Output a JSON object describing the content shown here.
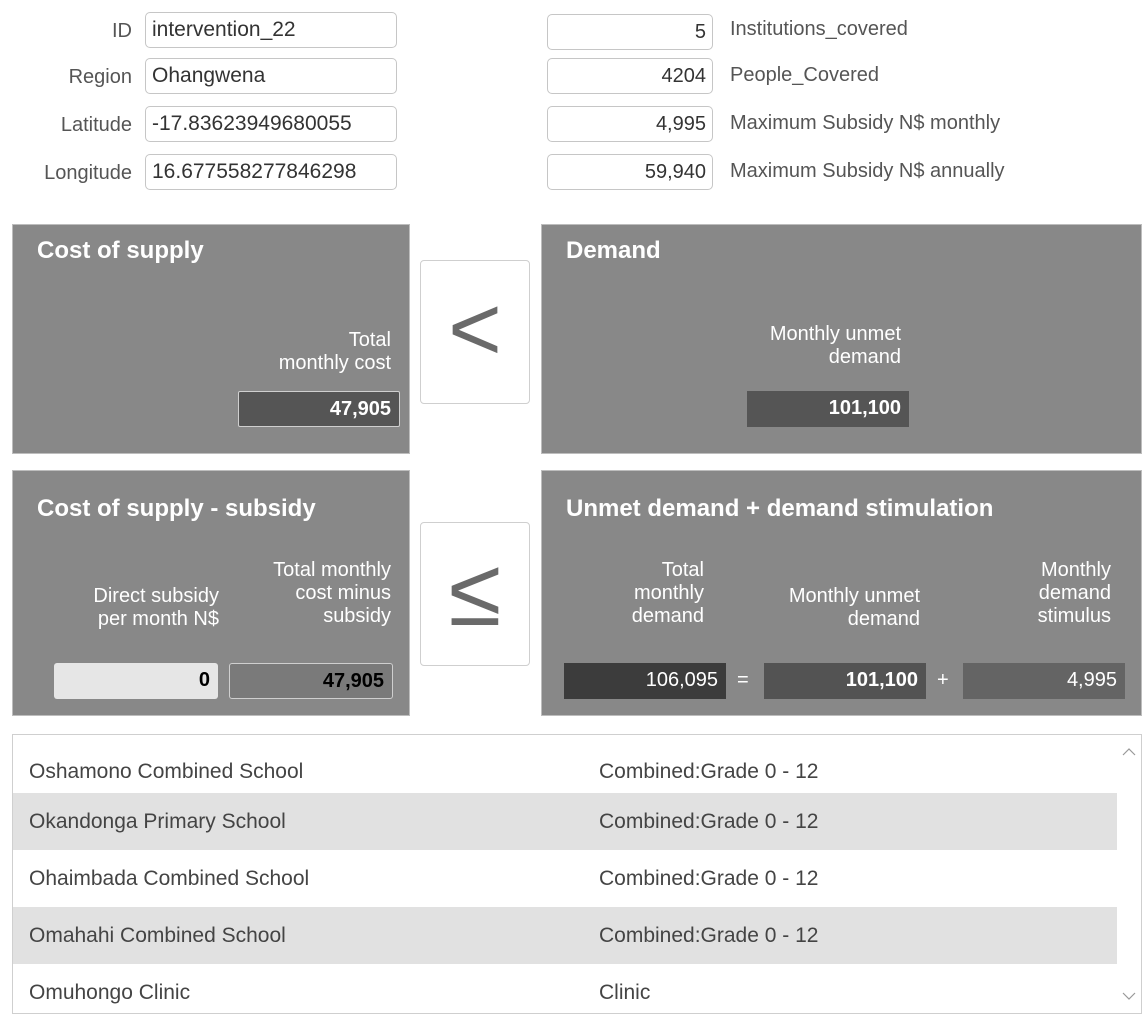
{
  "form": {
    "id_label": "ID",
    "id_value": "intervention_22",
    "region_label": "Region",
    "region_value": "Ohangwena",
    "latitude_label": "Latitude",
    "latitude_value": "-17.83623949680055",
    "longitude_label": "Longitude",
    "longitude_value": "16.677558277846298"
  },
  "stats": {
    "institutions_value": "5",
    "institutions_label": "Institutions_covered",
    "people_value": "4204",
    "people_label": "People_Covered",
    "subsidy_monthly_value": "4,995",
    "subsidy_monthly_label": "Maximum Subsidy N$ monthly",
    "subsidy_annual_value": "59,940",
    "subsidy_annual_label": "Maximum Subsidy N$ annually"
  },
  "supply": {
    "title": "Cost of supply",
    "total_label_1": "Total",
    "total_label_2": "monthly cost",
    "total_value": "47,905"
  },
  "comparison_1": "<",
  "demand": {
    "title": "Demand",
    "unmet_label_1": "Monthly unmet",
    "unmet_label_2": "demand",
    "unmet_value": "101,100"
  },
  "supply_subsidy": {
    "title": "Cost of supply - subsidy",
    "direct_label_1": "Direct subsidy",
    "direct_label_2": "per month N$",
    "direct_value": "0",
    "minus_label_1": "Total monthly",
    "minus_label_2": "cost minus",
    "minus_label_3": "subsidy",
    "minus_value": "47,905"
  },
  "comparison_2": "≤",
  "demand_stim": {
    "title": "Unmet demand + demand stimulation",
    "total_label_1": "Total",
    "total_label_2": "monthly",
    "total_label_3": "demand",
    "total_value": "106,095",
    "equals": "=",
    "unmet_label_1": "Monthly unmet",
    "unmet_label_2": "demand",
    "unmet_value": "101,100",
    "plus": "+",
    "stim_label_1": "Monthly",
    "stim_label_2": "demand",
    "stim_label_3": "stimulus",
    "stim_value": "4,995"
  },
  "institutions": [
    {
      "name": "Oshamono Combined School",
      "type": "Combined:Grade 0 - 12"
    },
    {
      "name": "Okandonga Primary School",
      "type": "Combined:Grade 0 - 12"
    },
    {
      "name": "Ohaimbada Combined School",
      "type": "Combined:Grade 0 - 12"
    },
    {
      "name": "Omahahi Combined School",
      "type": "Combined:Grade 0 - 12"
    },
    {
      "name": "Omuhongo Clinic",
      "type": "Clinic"
    }
  ],
  "scroll_icons": {
    "up": "chevron-up-icon",
    "down": "chevron-down-icon"
  }
}
